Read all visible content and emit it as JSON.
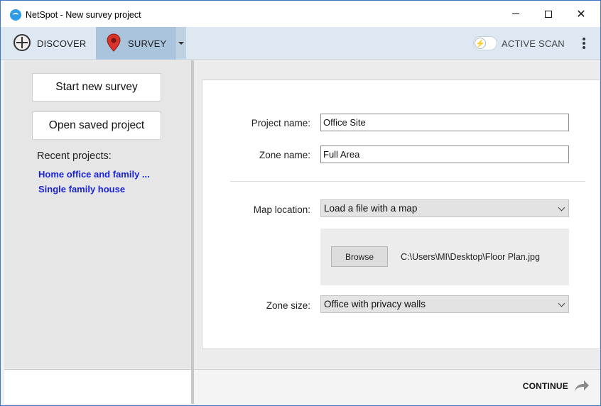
{
  "window": {
    "title": "NetSpot - New survey project"
  },
  "toolbar": {
    "discover_label": "DISCOVER",
    "survey_label": "SURVEY",
    "active_scan_label": "ACTIVE SCAN",
    "active_scan_on": false
  },
  "sidebar": {
    "start_new_label": "Start new survey",
    "open_saved_label": "Open saved project",
    "recent_title": "Recent projects:",
    "recent_projects": [
      "Home office and family ...",
      "Single family house"
    ]
  },
  "form": {
    "project_name_label": "Project name:",
    "project_name_value": "Office Site",
    "zone_name_label": "Zone name:",
    "zone_name_value": "Full Area",
    "map_location_label": "Map location:",
    "map_location_value": "Load a file with a map",
    "browse_label": "Browse",
    "file_path": "C:\\Users\\MI\\Desktop\\Floor Plan.jpg",
    "zone_size_label": "Zone size:",
    "zone_size_value": "Office with privacy walls"
  },
  "footer": {
    "continue_label": "CONTINUE"
  },
  "colors": {
    "accent": "#2e9be6",
    "toolbar_bg": "#dde8f2",
    "active_tab": "#a9c4dc",
    "link": "#1a24d6",
    "pin": "#d9342b"
  }
}
